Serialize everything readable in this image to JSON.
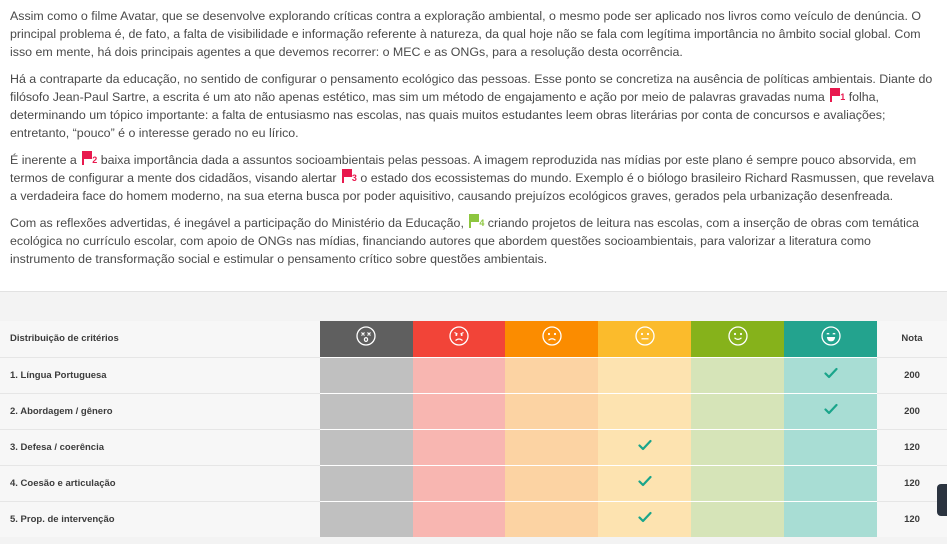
{
  "essay": {
    "paragraphs": [
      {
        "segments": [
          {
            "t": "Assim como o filme Avatar, que se desenvolve explorando críticas contra a exploração ambiental, o mesmo pode ser aplicado nos livros como veículo de denúncia. O\nprincipal problema é, de fato, a falta de visibilidade e informação referente à natureza, da qual hoje não se fala com legítima importância no âmbito social global. Com\nisso em mente, há dois principais agentes a que devemos recorrer: o MEC e as ONGs, para a resolução desta ocorrência."
          }
        ]
      },
      {
        "segments": [
          {
            "t": "Há a contraparte da educação, no sentido de configurar o pensamento ecológico das pessoas. Esse ponto se concretiza na ausência de políticas ambientais. Diante do\nfilósofo Jean-Paul Sartre, a escrita é um ato não apenas estético, mas sim um método de engajamento e ação por meio de palavras gravadas numa "
          },
          {
            "flag": "red",
            "n": "1"
          },
          {
            "t": " folha,\ndeterminando um tópico importante: a falta de entusiasmo nas escolas, nas quais muitos estudantes leem obras literárias por conta de concursos e avaliações;\nentretanto, “pouco” é o interesse gerado no eu lírico."
          }
        ]
      },
      {
        "segments": [
          {
            "t": "É inerente a "
          },
          {
            "flag": "red",
            "n": "2"
          },
          {
            "t": " baixa importância dada a assuntos socioambientais pelas pessoas. A imagem reproduzida nas mídias por este plano é sempre pouco absorvida, em\ntermos de configurar a mente dos cidadãos, visando alertar "
          },
          {
            "flag": "red",
            "n": "3"
          },
          {
            "t": " o estado dos ecossistemas do mundo. Exemplo é o biólogo brasileiro Richard Rasmussen, que revelava\na verdadeira face do homem moderno, na sua eterna busca por poder aquisitivo, causando prejuízos ecológicos graves, gerados pela urbanização desenfreada."
          }
        ]
      },
      {
        "segments": [
          {
            "t": "Com as reflexões advertidas, é inegável a participação do Ministério da Educação, "
          },
          {
            "flag": "green",
            "n": "4"
          },
          {
            "t": " criando projetos de leitura nas escolas, com a inserção de obras com temática\necológica no currículo escolar, com apoio de ONGs nas mídias, financiando autores que abordem questões socioambientais, para valorizar a literatura como\ninstrumento de transformação social e estimular o pensamento crítico sobre questões ambientais."
          }
        ]
      }
    ]
  },
  "grading": {
    "criteria_header": "Distribuição de critérios",
    "nota_header": "Nota",
    "levels": [
      {
        "icon": "dizzy-face-icon",
        "header_color": "#5f5f5f",
        "cell_color": "#c0c0c0"
      },
      {
        "icon": "angry-face-icon",
        "header_color": "#f24438",
        "cell_color": "#f8b6b1"
      },
      {
        "icon": "sad-face-icon",
        "header_color": "#fb8c00",
        "cell_color": "#fcd3a3"
      },
      {
        "icon": "neutral-face-icon",
        "header_color": "#fbbb2c",
        "cell_color": "#fde3b0"
      },
      {
        "icon": "smile-face-icon",
        "header_color": "#86b21b",
        "cell_color": "#d6e4b8"
      },
      {
        "icon": "grin-face-icon",
        "header_color": "#23a38e",
        "cell_color": "#a8ddd4"
      }
    ],
    "check_color": "#1aa58b",
    "rows": [
      {
        "label": "1. Língua Portuguesa",
        "selected_level": 5,
        "score": "200"
      },
      {
        "label": "2. Abordagem / gênero",
        "selected_level": 5,
        "score": "200"
      },
      {
        "label": "3. Defesa / coerência",
        "selected_level": 3,
        "score": "120"
      },
      {
        "label": "4. Coesão e articulação",
        "selected_level": 3,
        "score": "120"
      },
      {
        "label": "5. Prop. de intervenção",
        "selected_level": 3,
        "score": "120"
      }
    ]
  }
}
